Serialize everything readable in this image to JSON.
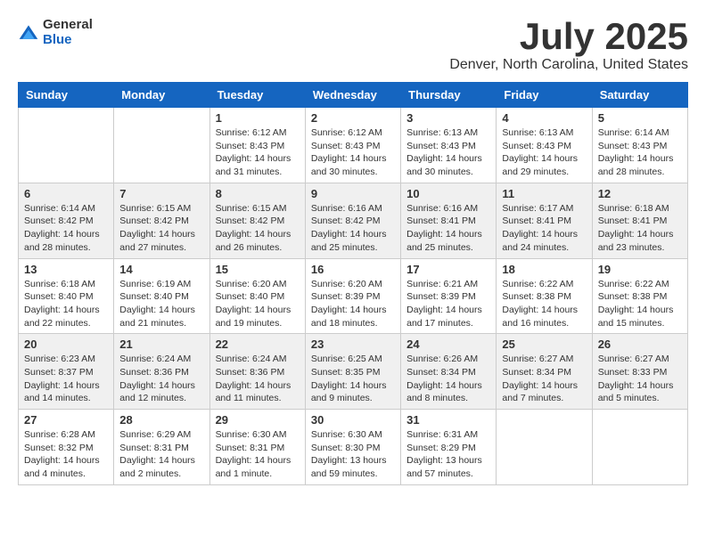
{
  "header": {
    "logo_general": "General",
    "logo_blue": "Blue",
    "month_title": "July 2025",
    "location": "Denver, North Carolina, United States"
  },
  "weekdays": [
    "Sunday",
    "Monday",
    "Tuesday",
    "Wednesday",
    "Thursday",
    "Friday",
    "Saturday"
  ],
  "weeks": [
    [
      {
        "day": "",
        "sunrise": "",
        "sunset": "",
        "daylight": ""
      },
      {
        "day": "",
        "sunrise": "",
        "sunset": "",
        "daylight": ""
      },
      {
        "day": "1",
        "sunrise": "Sunrise: 6:12 AM",
        "sunset": "Sunset: 8:43 PM",
        "daylight": "Daylight: 14 hours and 31 minutes."
      },
      {
        "day": "2",
        "sunrise": "Sunrise: 6:12 AM",
        "sunset": "Sunset: 8:43 PM",
        "daylight": "Daylight: 14 hours and 30 minutes."
      },
      {
        "day": "3",
        "sunrise": "Sunrise: 6:13 AM",
        "sunset": "Sunset: 8:43 PM",
        "daylight": "Daylight: 14 hours and 30 minutes."
      },
      {
        "day": "4",
        "sunrise": "Sunrise: 6:13 AM",
        "sunset": "Sunset: 8:43 PM",
        "daylight": "Daylight: 14 hours and 29 minutes."
      },
      {
        "day": "5",
        "sunrise": "Sunrise: 6:14 AM",
        "sunset": "Sunset: 8:43 PM",
        "daylight": "Daylight: 14 hours and 28 minutes."
      }
    ],
    [
      {
        "day": "6",
        "sunrise": "Sunrise: 6:14 AM",
        "sunset": "Sunset: 8:42 PM",
        "daylight": "Daylight: 14 hours and 28 minutes."
      },
      {
        "day": "7",
        "sunrise": "Sunrise: 6:15 AM",
        "sunset": "Sunset: 8:42 PM",
        "daylight": "Daylight: 14 hours and 27 minutes."
      },
      {
        "day": "8",
        "sunrise": "Sunrise: 6:15 AM",
        "sunset": "Sunset: 8:42 PM",
        "daylight": "Daylight: 14 hours and 26 minutes."
      },
      {
        "day": "9",
        "sunrise": "Sunrise: 6:16 AM",
        "sunset": "Sunset: 8:42 PM",
        "daylight": "Daylight: 14 hours and 25 minutes."
      },
      {
        "day": "10",
        "sunrise": "Sunrise: 6:16 AM",
        "sunset": "Sunset: 8:41 PM",
        "daylight": "Daylight: 14 hours and 25 minutes."
      },
      {
        "day": "11",
        "sunrise": "Sunrise: 6:17 AM",
        "sunset": "Sunset: 8:41 PM",
        "daylight": "Daylight: 14 hours and 24 minutes."
      },
      {
        "day": "12",
        "sunrise": "Sunrise: 6:18 AM",
        "sunset": "Sunset: 8:41 PM",
        "daylight": "Daylight: 14 hours and 23 minutes."
      }
    ],
    [
      {
        "day": "13",
        "sunrise": "Sunrise: 6:18 AM",
        "sunset": "Sunset: 8:40 PM",
        "daylight": "Daylight: 14 hours and 22 minutes."
      },
      {
        "day": "14",
        "sunrise": "Sunrise: 6:19 AM",
        "sunset": "Sunset: 8:40 PM",
        "daylight": "Daylight: 14 hours and 21 minutes."
      },
      {
        "day": "15",
        "sunrise": "Sunrise: 6:20 AM",
        "sunset": "Sunset: 8:40 PM",
        "daylight": "Daylight: 14 hours and 19 minutes."
      },
      {
        "day": "16",
        "sunrise": "Sunrise: 6:20 AM",
        "sunset": "Sunset: 8:39 PM",
        "daylight": "Daylight: 14 hours and 18 minutes."
      },
      {
        "day": "17",
        "sunrise": "Sunrise: 6:21 AM",
        "sunset": "Sunset: 8:39 PM",
        "daylight": "Daylight: 14 hours and 17 minutes."
      },
      {
        "day": "18",
        "sunrise": "Sunrise: 6:22 AM",
        "sunset": "Sunset: 8:38 PM",
        "daylight": "Daylight: 14 hours and 16 minutes."
      },
      {
        "day": "19",
        "sunrise": "Sunrise: 6:22 AM",
        "sunset": "Sunset: 8:38 PM",
        "daylight": "Daylight: 14 hours and 15 minutes."
      }
    ],
    [
      {
        "day": "20",
        "sunrise": "Sunrise: 6:23 AM",
        "sunset": "Sunset: 8:37 PM",
        "daylight": "Daylight: 14 hours and 14 minutes."
      },
      {
        "day": "21",
        "sunrise": "Sunrise: 6:24 AM",
        "sunset": "Sunset: 8:36 PM",
        "daylight": "Daylight: 14 hours and 12 minutes."
      },
      {
        "day": "22",
        "sunrise": "Sunrise: 6:24 AM",
        "sunset": "Sunset: 8:36 PM",
        "daylight": "Daylight: 14 hours and 11 minutes."
      },
      {
        "day": "23",
        "sunrise": "Sunrise: 6:25 AM",
        "sunset": "Sunset: 8:35 PM",
        "daylight": "Daylight: 14 hours and 9 minutes."
      },
      {
        "day": "24",
        "sunrise": "Sunrise: 6:26 AM",
        "sunset": "Sunset: 8:34 PM",
        "daylight": "Daylight: 14 hours and 8 minutes."
      },
      {
        "day": "25",
        "sunrise": "Sunrise: 6:27 AM",
        "sunset": "Sunset: 8:34 PM",
        "daylight": "Daylight: 14 hours and 7 minutes."
      },
      {
        "day": "26",
        "sunrise": "Sunrise: 6:27 AM",
        "sunset": "Sunset: 8:33 PM",
        "daylight": "Daylight: 14 hours and 5 minutes."
      }
    ],
    [
      {
        "day": "27",
        "sunrise": "Sunrise: 6:28 AM",
        "sunset": "Sunset: 8:32 PM",
        "daylight": "Daylight: 14 hours and 4 minutes."
      },
      {
        "day": "28",
        "sunrise": "Sunrise: 6:29 AM",
        "sunset": "Sunset: 8:31 PM",
        "daylight": "Daylight: 14 hours and 2 minutes."
      },
      {
        "day": "29",
        "sunrise": "Sunrise: 6:30 AM",
        "sunset": "Sunset: 8:31 PM",
        "daylight": "Daylight: 14 hours and 1 minute."
      },
      {
        "day": "30",
        "sunrise": "Sunrise: 6:30 AM",
        "sunset": "Sunset: 8:30 PM",
        "daylight": "Daylight: 13 hours and 59 minutes."
      },
      {
        "day": "31",
        "sunrise": "Sunrise: 6:31 AM",
        "sunset": "Sunset: 8:29 PM",
        "daylight": "Daylight: 13 hours and 57 minutes."
      },
      {
        "day": "",
        "sunrise": "",
        "sunset": "",
        "daylight": ""
      },
      {
        "day": "",
        "sunrise": "",
        "sunset": "",
        "daylight": ""
      }
    ]
  ],
  "row_shading": [
    false,
    true,
    false,
    true,
    false
  ]
}
